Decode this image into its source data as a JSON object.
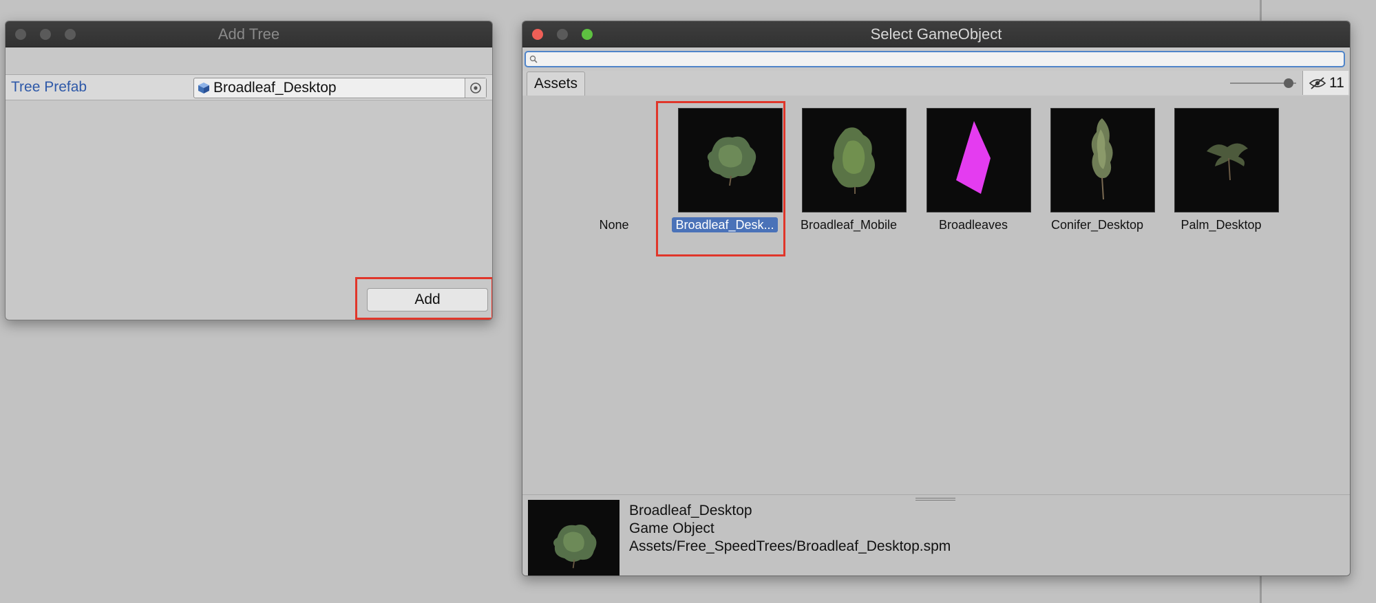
{
  "add_tree_window": {
    "title": "Add Tree",
    "field_label": "Tree Prefab",
    "field_value": "Broadleaf_Desktop",
    "add_button": "Add"
  },
  "select_window": {
    "title": "Select GameObject",
    "search_value": "",
    "tab_assets": "Assets",
    "hidden_count": "11",
    "items": [
      {
        "label": "None"
      },
      {
        "label": "Broadleaf_Desk..."
      },
      {
        "label": "Broadleaf_Mobile"
      },
      {
        "label": "Broadleaves"
      },
      {
        "label": "Conifer_Desktop"
      },
      {
        "label": "Palm_Desktop"
      }
    ],
    "preview": {
      "name": "Broadleaf_Desktop",
      "type": "Game Object",
      "path": "Assets/Free_SpeedTrees/Broadleaf_Desktop.spm"
    }
  },
  "colors": {
    "highlight": "#e0362a",
    "selection": "#4a72b8",
    "label_blue": "#2d58a8"
  }
}
